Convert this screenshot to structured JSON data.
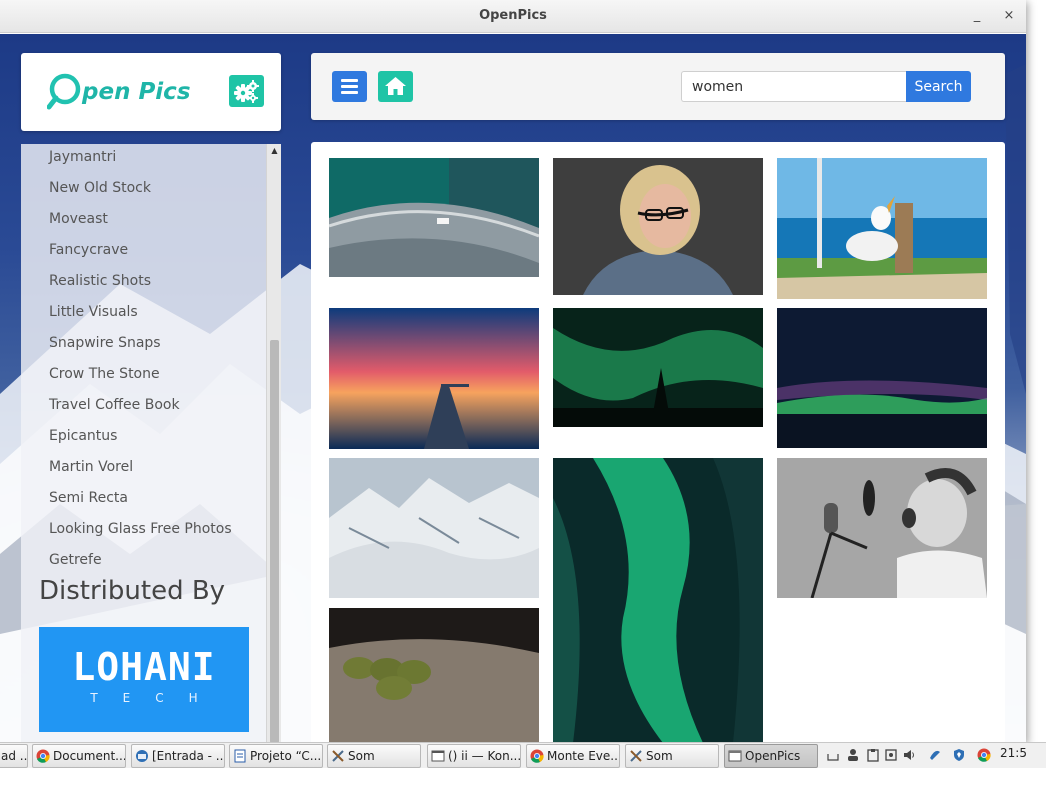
{
  "window": {
    "title": "OpenPics",
    "minimize_glyph": "_",
    "close_glyph": "×"
  },
  "logo": {
    "text": "pen Pics",
    "icon": "magnifier-o-icon",
    "settings_icon": "gears-icon"
  },
  "sidebar": {
    "sources": [
      "Jaymantri",
      "New Old Stock",
      "Moveast",
      "Fancycrave",
      "Realistic Shots",
      "Little Visuals",
      "Snapwire Snaps",
      "Crow The Stone",
      "Travel Coffee Book",
      "Epicantus",
      "Martin Vorel",
      "Semi Recta",
      "Looking Glass Free Photos",
      "Getrefe"
    ],
    "distributed_by": "Distributed By",
    "sponsor": {
      "name": "LOHANI",
      "subtitle": "TECH"
    }
  },
  "toolbar": {
    "menu_icon": "hamburger-icon",
    "home_icon": "home-icon",
    "search_value": "women",
    "search_label": "Search"
  },
  "colors": {
    "accent_blue": "#2f79df",
    "accent_teal": "#1fc4a6",
    "sponsor_blue": "#2196f3"
  },
  "gallery": {
    "photos": [
      {
        "id": "road-aerial"
      },
      {
        "id": "man-glasses"
      },
      {
        "id": "seagull"
      },
      {
        "id": "sunset-pier"
      },
      {
        "id": "aurora-tree"
      },
      {
        "id": "aurora-horizon"
      },
      {
        "id": "glacier"
      },
      {
        "id": "aurora-vertical"
      },
      {
        "id": "boy-microphone"
      },
      {
        "id": "pears"
      }
    ]
  },
  "taskbar": {
    "tasks": [
      {
        "label": "ad ...",
        "icon": ""
      },
      {
        "label": "Document...",
        "icon": "chrome-icon"
      },
      {
        "label": "[Entrada - ...",
        "icon": "thunderbird-icon"
      },
      {
        "label": "Projeto “C...",
        "icon": "document-icon"
      },
      {
        "label": "Som",
        "icon": "tools-icon"
      },
      {
        "label": "() ii — Kon...",
        "icon": "terminal-icon"
      },
      {
        "label": "Monte Eve...",
        "icon": "chrome-icon"
      },
      {
        "label": "Som",
        "icon": "tools-icon"
      },
      {
        "label": "OpenPics",
        "icon": "window-icon"
      }
    ],
    "clock": "21:5"
  }
}
